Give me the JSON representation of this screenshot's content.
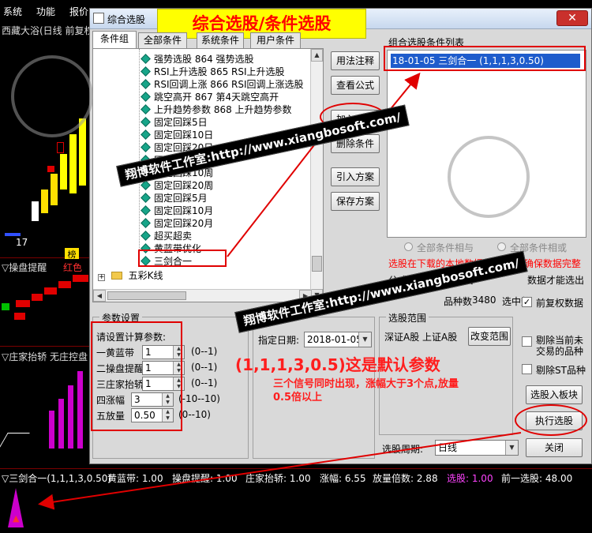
{
  "menu": [
    "系统",
    "功能",
    "报价"
  ],
  "chart": {
    "title": "西藏大浴(日线 前复权",
    "price_marker": "17",
    "ind1_label": "▽操盘提醒",
    "ind1_extra": "红色",
    "ind1_tag": "榜",
    "ind2_label": "▽庄家抬轿  无庄控盘"
  },
  "dialog": {
    "title": "综合选股",
    "close": "✕",
    "banner": "综合选股/条件选股",
    "tabs": [
      "条件组",
      "全部条件",
      "系统条件",
      "用户条件"
    ],
    "tree_items": [
      "强势选股 864 强势选股",
      "RSI上升选股 865 RSI上升选股",
      "RSI回调上涨 866 RSI回调上涨选股",
      "跳空高开 867 第4天跳空高开",
      "上升趋势参数 868 上升趋势参数",
      "固定回踩5日",
      "固定回踩10日",
      "固定回踩20日",
      "固定回踩5周",
      "固定回踩10周",
      "固定回踩20周",
      "固定回踩5月",
      "固定回踩10月",
      "固定回踩20月",
      "超买超卖",
      "黄蓝带优化",
      "三剑合一"
    ],
    "tree_folder": "五彩K线",
    "buttons": {
      "usage": "用法注释",
      "view_formula": "查看公式",
      "add": "加入条件",
      "delete": "删除条件",
      "import": "引入方案",
      "save": "保存方案",
      "to_block": "选股入板块",
      "run": "执行选股",
      "close": "关闭",
      "change_range": "改变范围"
    },
    "combo_label": "组合选股条件列表",
    "combo_items": [
      "18-01-05  三剑合一  (1,1,1,3,0.50)"
    ],
    "radio_and": "全部条件相与",
    "radio_or": "全部条件相或",
    "warn1": "选股在下载的本地数据中进行,请确保数据完整",
    "warn2": "公式类选股至少需要",
    "warn2_end": "数据才能选出",
    "stock_count_label": "品种数",
    "stock_count": "3480",
    "selected_label": "选中数",
    "params": {
      "group_title": "参数设置",
      "prompt": "请设置计算参数:",
      "rows": [
        {
          "name": "一黄蓝带",
          "value": "1",
          "range": "(0--1)"
        },
        {
          "name": "二操盘提醒",
          "value": "1",
          "range": "(0--1)"
        },
        {
          "name": "三庄家抬轿",
          "value": "1",
          "range": "(0--1)"
        },
        {
          "name": "四涨幅",
          "value": "3",
          "range": "(-10--10)"
        },
        {
          "name": "五放量",
          "value": "0.50",
          "range": "(0--10)"
        }
      ]
    },
    "date_label": "指定日期:",
    "date_value": "2018-01-05",
    "range_group": "选股范围",
    "range_value": "深证A股  上证A股",
    "checks": [
      {
        "label": "前复权数据",
        "checked": true
      },
      {
        "label": "剔除当前未交易的品种",
        "checked": false
      },
      {
        "label": "剔除ST品种",
        "checked": false
      }
    ],
    "period_label": "选股周期:",
    "period_value": "日线"
  },
  "annotations": {
    "default_params": "(1,1,1,3,0.5)这是默认参数",
    "note": "三个信号同时出现，涨幅大于3个点,放量0.5倍以上",
    "watermark": "翔博软件工作室:http://www.xiangbosoft.com/"
  },
  "bottom_bar": {
    "label": "▽三剑合一(1,1,1,3,0.50)",
    "items": [
      {
        "text": "黄蓝带: 1.00",
        "color": "#ffffff"
      },
      {
        "text": "操盘提醒: 1.00",
        "color": "#ffffff"
      },
      {
        "text": "庄家抬轿: 1.00",
        "color": "#ffffff"
      },
      {
        "text": "涨幅: 6.55",
        "color": "#ffffff"
      },
      {
        "text": "放量倍数: 2.88",
        "color": "#ffffff"
      },
      {
        "text": "选股: 1.00",
        "color": "#ff44ff"
      },
      {
        "text": "前一选股: 48.00",
        "color": "#ffffff"
      }
    ]
  }
}
